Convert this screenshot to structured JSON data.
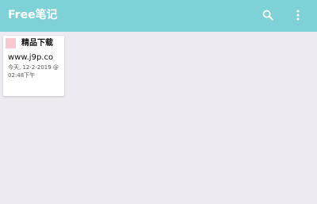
{
  "app_bar": {
    "title": "Free笔记",
    "color": "#7ED1D6",
    "search_icon": "search-icon",
    "more_icon": "more-vert-icon"
  },
  "notes": [
    {
      "title": "精品下载",
      "body": "www.j9p.co",
      "date": "今天, 12-2-2019 @ 02:48下午",
      "color": "#F8C8D0"
    }
  ]
}
